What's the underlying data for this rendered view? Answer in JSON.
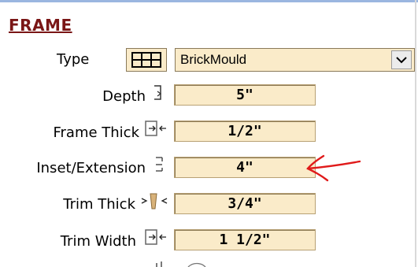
{
  "section": {
    "title": "FRAME"
  },
  "type": {
    "label": "Type",
    "value": "BrickMould",
    "grid_icon": "grid-icon",
    "dropdown_icon": "chevron-down-icon"
  },
  "fields": [
    {
      "label": "Depth",
      "value": "5\"",
      "icon": "depth-icon"
    },
    {
      "label": "Frame Thick",
      "value": "1/2\"",
      "icon": "frame-thick-icon"
    },
    {
      "label": "Inset/Extension",
      "value": "4\"",
      "icon": "inset-extension-icon"
    },
    {
      "label": "Trim Thick",
      "value": "3/4\"",
      "icon": "trim-thick-icon"
    },
    {
      "label": "Trim Width",
      "value": "1 1/2\"",
      "icon": "trim-width-icon"
    }
  ],
  "colors": {
    "section_title": "#7a1616",
    "field_bg": "#faebc9",
    "annotation_arrow": "#e01a1a"
  }
}
